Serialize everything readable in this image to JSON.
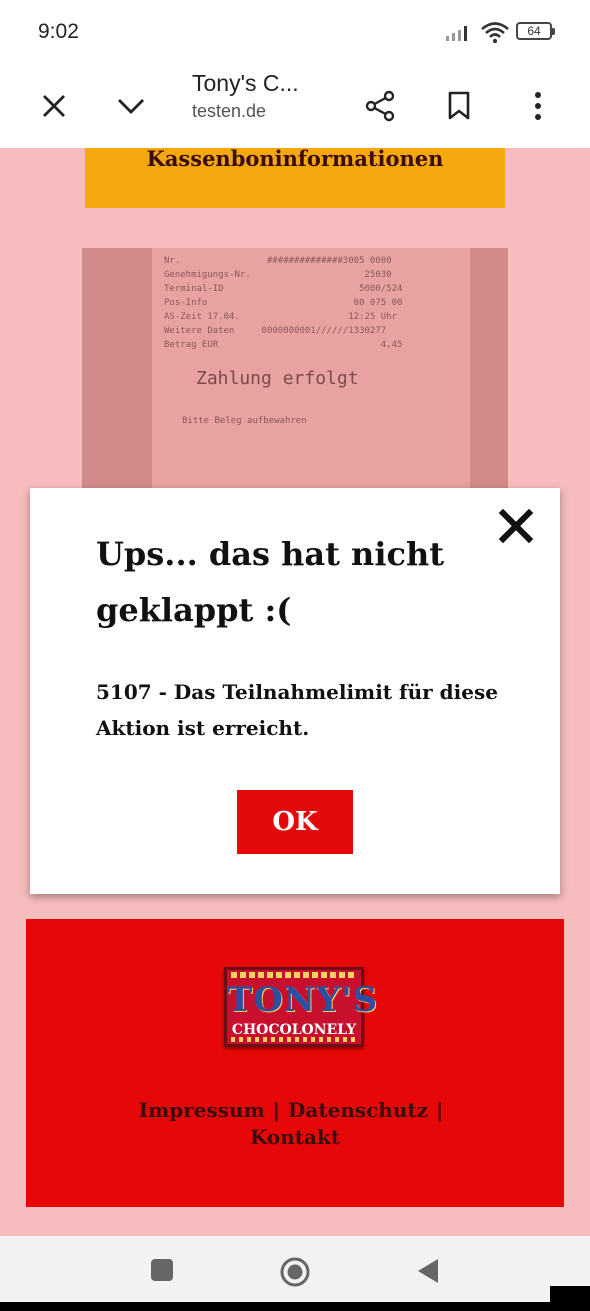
{
  "status_bar": {
    "time": "9:02",
    "battery": "64",
    "icons": [
      "signal-icon",
      "wifi-icon",
      "battery-icon"
    ]
  },
  "browser": {
    "title": "Tony's C...",
    "domain": "testen.de",
    "icons": [
      "close-icon",
      "chevron-down-icon",
      "share-icon",
      "bookmark-icon",
      "more-vert-icon"
    ]
  },
  "page": {
    "section_header": "Kassenboninformationen",
    "receipt": {
      "lines": [
        "Nr.                ##############3005 0000",
        "Genehmigungs-Nr.                     25030",
        "Terminal-ID                         5000/524",
        "Pos-Info                           00 075 00",
        "AS-Zeit 17.04.                    12:25 Uhr",
        "Weitere Daten     0000000001//////1330277",
        "Betrag EUR                              4,45"
      ],
      "status": "Zahlung erfolgt",
      "note": "Bitte Beleg aufbewahren"
    }
  },
  "modal": {
    "heading": "Ups... das hat nicht geklappt :(",
    "message": "5107 - Das Teilnahmelimit für diese Aktion ist erreicht.",
    "ok_label": "OK",
    "accent_color": "#e40a0c"
  },
  "footer": {
    "logo_name": "TONY'S",
    "logo_sub": "CHOCOLONELY",
    "links": [
      "Impressum",
      "Datenschutz",
      "Kontakt"
    ],
    "separator": "|",
    "background_color": "#e60808"
  },
  "nav": {
    "icons": [
      "recents-square-icon",
      "home-circle-icon",
      "back-triangle-icon"
    ]
  }
}
